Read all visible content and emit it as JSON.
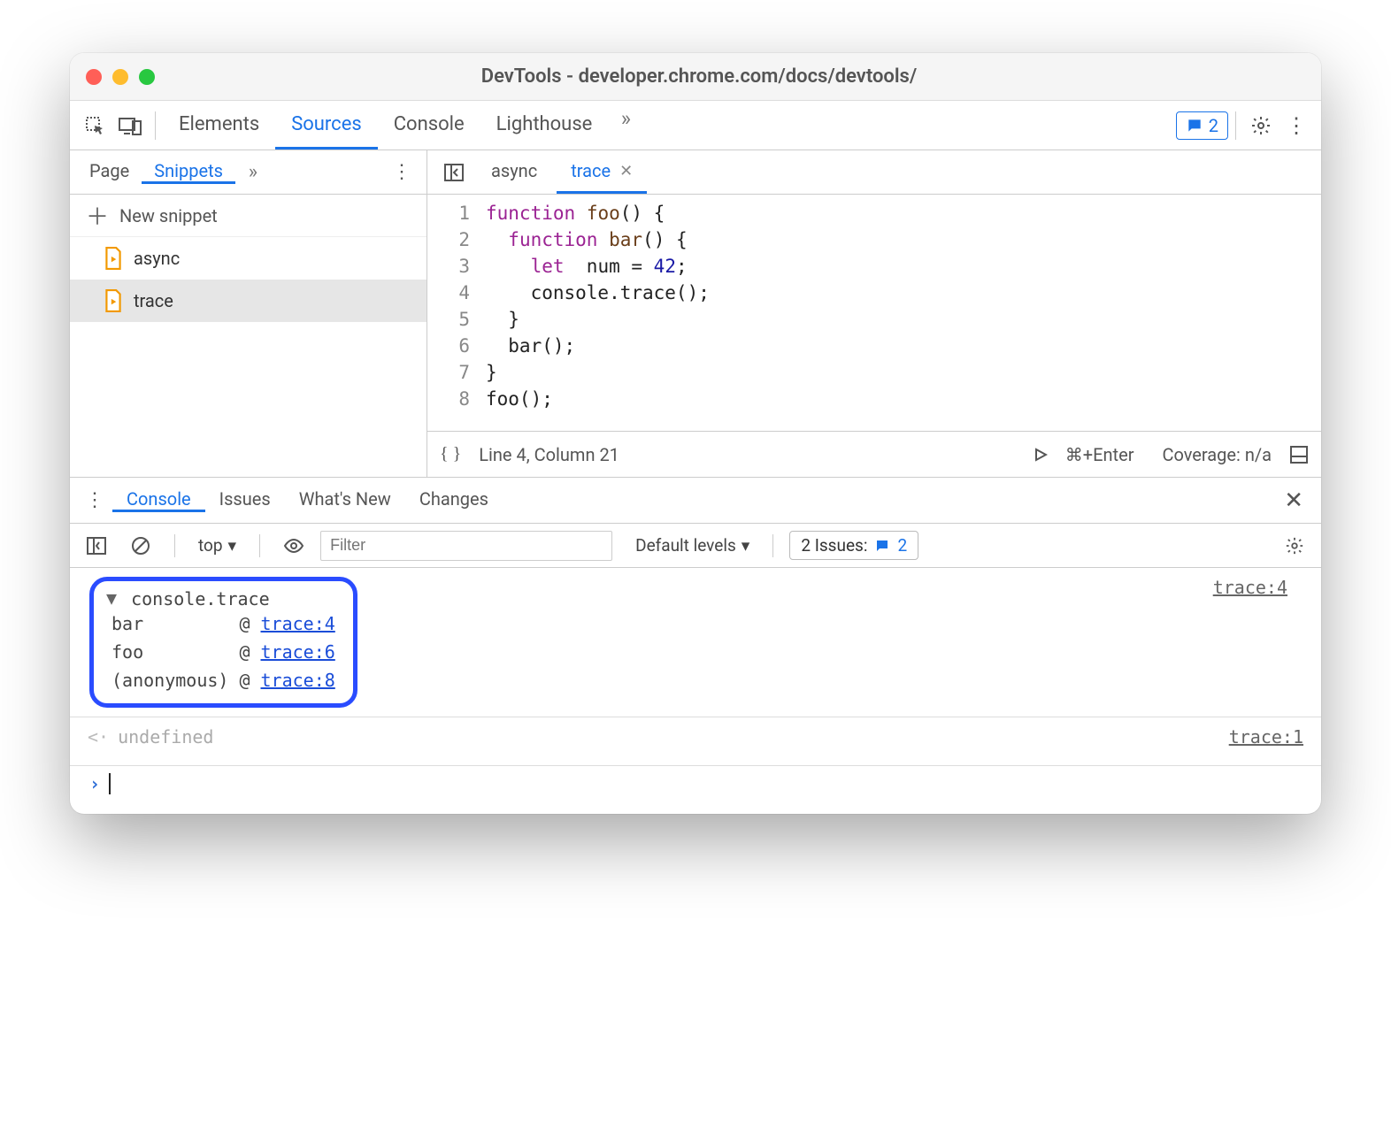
{
  "window": {
    "title": "DevTools - developer.chrome.com/docs/devtools/"
  },
  "main_tabs": {
    "items": [
      "Elements",
      "Sources",
      "Console",
      "Lighthouse"
    ],
    "active": "Sources",
    "badge_count": "2"
  },
  "sidebar": {
    "tabs": [
      "Page",
      "Snippets"
    ],
    "active": "Snippets",
    "new_snippet_label": "New snippet",
    "files": [
      {
        "name": "async",
        "selected": false
      },
      {
        "name": "trace",
        "selected": true
      }
    ]
  },
  "editor": {
    "tabs": [
      {
        "name": "async",
        "active": false,
        "closeable": false
      },
      {
        "name": "trace",
        "active": true,
        "closeable": true
      }
    ],
    "code": {
      "line_count": 8,
      "lines": [
        {
          "kw1": "function",
          "fn": "foo",
          "rest": "() {"
        },
        {
          "indent": "  ",
          "kw1": "function",
          "fn": "bar",
          "rest": "() {"
        },
        {
          "indent": "    ",
          "kw1": "let",
          "plain": " num = ",
          "num": "42",
          "tail": ";"
        },
        {
          "indent": "    ",
          "plain": "console.trace();"
        },
        {
          "indent": "  ",
          "plain": "}"
        },
        {
          "indent": "  ",
          "plain": "bar();"
        },
        {
          "plain": "}"
        },
        {
          "plain": "foo();"
        }
      ]
    },
    "status": {
      "pos": "Line 4, Column 21",
      "shortcut": "⌘+Enter",
      "coverage": "Coverage: n/a"
    }
  },
  "drawer": {
    "tabs": [
      "Console",
      "Issues",
      "What's New",
      "Changes"
    ],
    "active": "Console"
  },
  "console_toolbar": {
    "context": "top",
    "filter_placeholder": "Filter",
    "levels": "Default levels",
    "issues_label": "2 Issues:",
    "issues_count": "2"
  },
  "console": {
    "trace_header": "console.trace",
    "source_ref": "trace:4",
    "stack": [
      {
        "fn": "bar",
        "loc": "trace:4"
      },
      {
        "fn": "foo",
        "loc": "trace:6"
      },
      {
        "fn": "(anonymous)",
        "loc": "trace:8"
      }
    ],
    "return_value": "undefined",
    "return_source": "trace:1"
  }
}
